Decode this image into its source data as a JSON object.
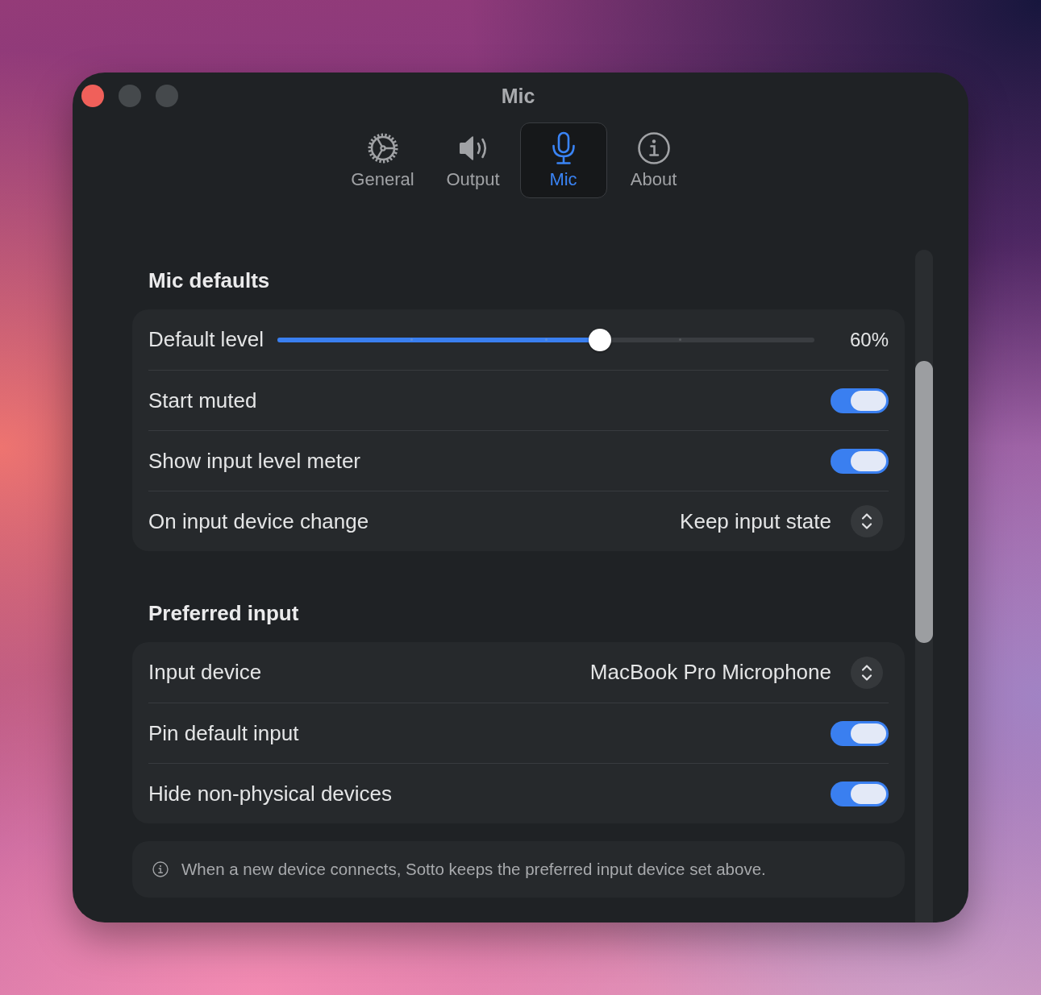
{
  "window": {
    "title": "Mic",
    "buttons": [
      {
        "disabled": false
      },
      {
        "disabled": true
      },
      {
        "disabled": true
      }
    ]
  },
  "tabs": [
    {
      "label": "General",
      "selected": false
    },
    {
      "label": "Output",
      "selected": false
    },
    {
      "label": "Mic",
      "selected": true
    },
    {
      "label": "About",
      "selected": false
    }
  ],
  "sections": [
    {
      "heading": "Mic defaults",
      "rows": [
        {
          "kind": "slider",
          "label": "Default level",
          "level": 0.6,
          "reading": "60%"
        },
        {
          "kind": "toggle",
          "label": "Start muted",
          "on": true
        },
        {
          "kind": "toggle",
          "label": "Show input level meter",
          "on": true
        },
        {
          "kind": "select",
          "label": "On input device change",
          "value": "Keep input state"
        }
      ]
    },
    {
      "heading": "Preferred input",
      "rows": [
        {
          "kind": "select",
          "label": "Input device",
          "value": "MacBook Pro Microphone"
        },
        {
          "kind": "toggle",
          "label": "Pin default input",
          "on": true
        },
        {
          "kind": "toggle",
          "label": "Hide non-physical devices",
          "on": true
        }
      ]
    }
  ],
  "note": {
    "text": "When a new device connects, Sotto keeps the preferred input device set above."
  }
}
